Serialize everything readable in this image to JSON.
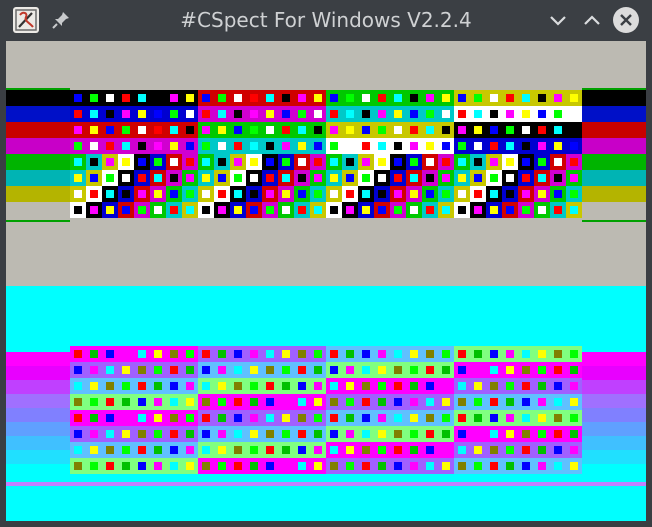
{
  "window": {
    "title": "#CSpect For Windows V2.2.4",
    "icons": {
      "app": "cspect-app-icon",
      "pin": "pin-icon",
      "minimize": "chevron-down-icon",
      "maximize": "chevron-up-icon",
      "close": "close-icon"
    }
  },
  "colors": {
    "titlebar": "#3b3f44",
    "title_text": "#cfd1d3",
    "border_grey": "#bcbab2",
    "cyan": "#00ffff"
  }
}
